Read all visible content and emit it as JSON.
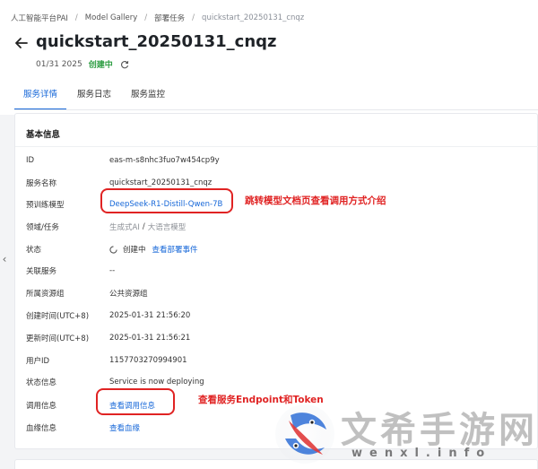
{
  "breadcrumb": [
    "人工智能平台PAI",
    "Model Gallery",
    "部署任务",
    "quickstart_20250131_cnqz"
  ],
  "header": {
    "title": "quickstart_20250131_cnqz",
    "date": "01/31 2025",
    "status": "创建中"
  },
  "tabs": [
    {
      "label": "服务详情",
      "active": true
    },
    {
      "label": "服务日志",
      "active": false
    },
    {
      "label": "服务监控",
      "active": false
    }
  ],
  "card": {
    "title": "基本信息",
    "rows": {
      "id": {
        "label": "ID",
        "value": "eas-m-s8nhc3fuo7w454cp9y"
      },
      "service_name": {
        "label": "服务名称",
        "value": "quickstart_20250131_cnqz"
      },
      "pretrained_model": {
        "label": "预训练模型",
        "value": "DeepSeek-R1-Distill-Qwen-7B"
      },
      "domain_task": {
        "label": "领域/任务",
        "value_a": "生成式AI",
        "slash": "/",
        "value_b": "大语言模型"
      },
      "state": {
        "label": "状态",
        "value": "创建中",
        "link": "查看部署事件"
      },
      "related_service": {
        "label": "关联服务",
        "value": "--"
      },
      "resource_group": {
        "label": "所属资源组",
        "value": "公共资源组"
      },
      "created_time": {
        "label": "创建时间(UTC+8)",
        "value": "2025-01-31 21:56:20"
      },
      "updated_time": {
        "label": "更新时间(UTC+8)",
        "value": "2025-01-31 21:56:21"
      },
      "user_id": {
        "label": "用户ID",
        "value": "1157703270994901"
      },
      "state_info": {
        "label": "状态信息",
        "value": "Service is now deploying"
      },
      "invoke_info": {
        "label": "调用信息",
        "link": "查看调用信息"
      },
      "lineage_info": {
        "label": "血缘信息",
        "link": "查看血缘"
      }
    }
  },
  "annotations": {
    "model_doc": "跳转模型文档页查看调用方式介绍",
    "endpoint_token": "查看服务Endpoint和Token"
  },
  "watermark": {
    "text": "文希手游网",
    "sub": "wenxl.info"
  },
  "colors": {
    "link": "#1667d8",
    "status_green": "#2f9e44",
    "annotation_red": "#e02323"
  }
}
